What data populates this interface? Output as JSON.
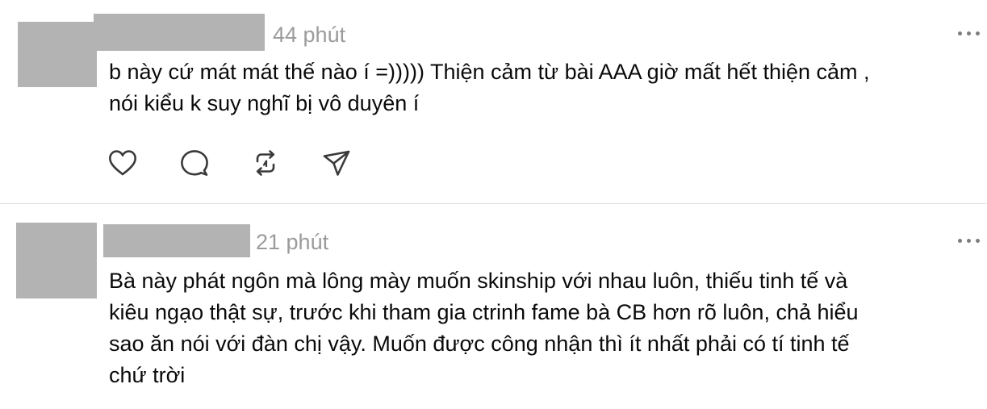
{
  "comments": [
    {
      "time": "44 phút",
      "lines": [
        "b này cứ mát mát thế nào í =))))) Thiện cảm từ bài AAA giờ mất hết thiện cảm ,",
        "nói kiểu k suy nghĩ bị vô duyên í"
      ],
      "actions": [
        "heart-icon",
        "comment-icon",
        "repost-icon",
        "share-icon"
      ]
    },
    {
      "time": "21 phút",
      "lines": [
        "Bà này phát ngôn mà lông mày muốn skinship với nhau luôn, thiếu tinh tế và",
        "kiêu ngạo thật sự, trước khi tham gia ctrinh fame bà CB hơn rõ luôn, chả hiểu",
        "sao ăn nói với đàn chị vậy. Muốn được công nhận thì ít nhất phải có tí tinh tế",
        "chứ trời"
      ]
    }
  ],
  "colors": {
    "redaction": "#b3b3b3",
    "meta_text": "#9b9b9b",
    "body_text": "#0a0a0a",
    "divider": "#dcdcdc",
    "icon": "#3a3a3a"
  }
}
